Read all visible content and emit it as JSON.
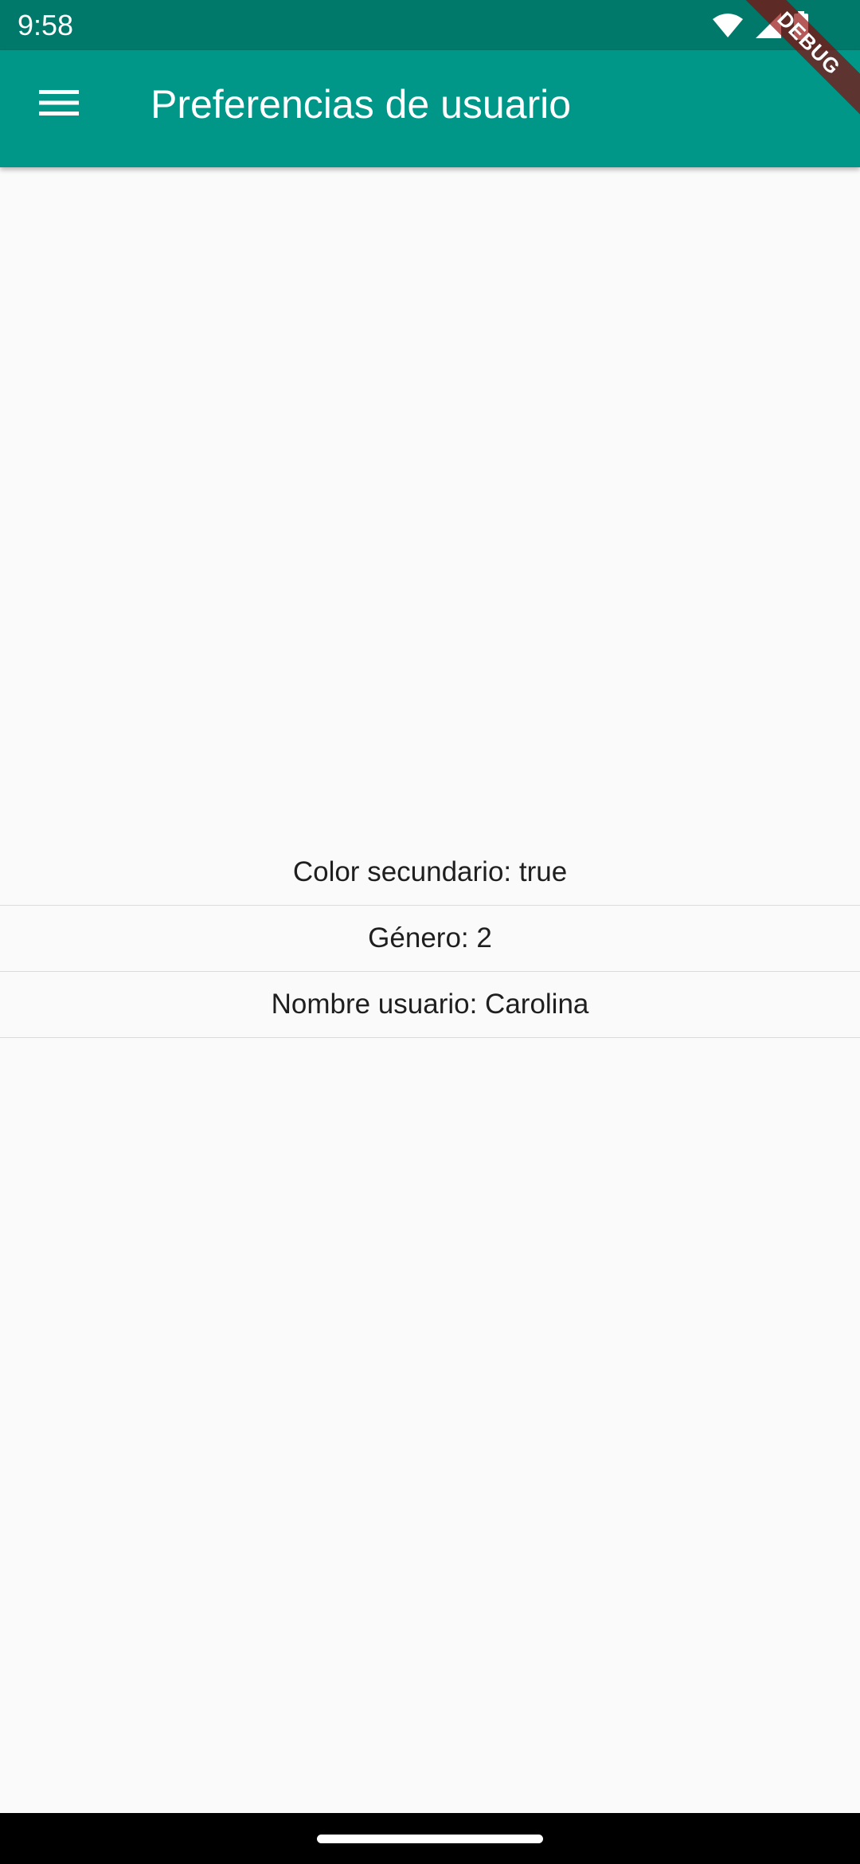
{
  "status_bar": {
    "time": "9:58",
    "icons": [
      "wifi-icon",
      "signal-icon",
      "battery-icon"
    ]
  },
  "app_bar": {
    "title": "Preferencias de usuario",
    "menu_icon": "menu-icon",
    "color": "#009688"
  },
  "debug_banner": {
    "label": "DEBUG"
  },
  "preferences": {
    "items": [
      {
        "text": "Color secundario: true"
      },
      {
        "text": "Género: 2"
      },
      {
        "text": "Nombre usuario: Carolina"
      }
    ]
  },
  "colors": {
    "status_bar": "#00796b",
    "app_bar": "#009688",
    "background": "#fafafa"
  }
}
